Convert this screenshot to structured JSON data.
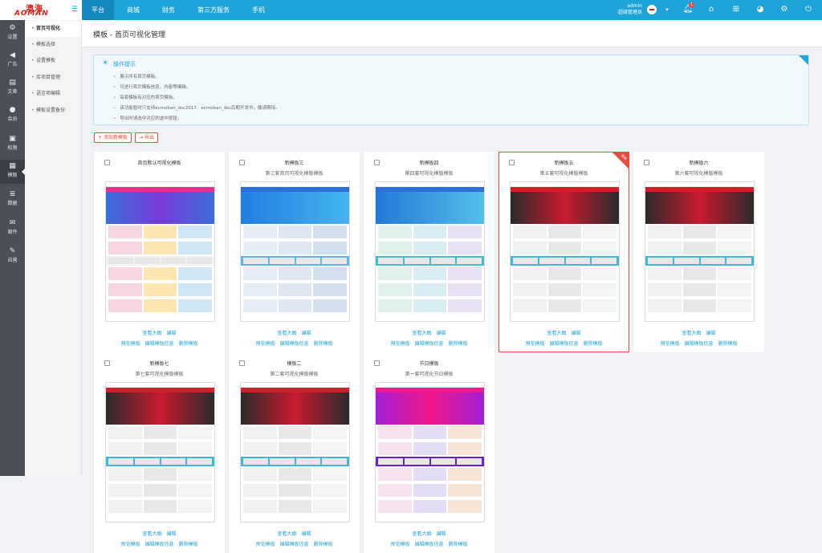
{
  "brand": {
    "line1": "澳海",
    "line2": "AOMAN"
  },
  "topnav": {
    "items": [
      "平台",
      "商城",
      "财务",
      "第三方服务",
      "手机"
    ],
    "active": 0
  },
  "user": {
    "name": "admin",
    "role": "超级管理员"
  },
  "notification_count": "1",
  "sidebar": {
    "items": [
      "设置",
      "广告",
      "文章",
      "会员",
      "权限",
      "模板",
      "数据",
      "邮件",
      "自营"
    ],
    "active": 5
  },
  "subnav": {
    "items": [
      "首页可视化",
      "模板选择",
      "设置模板",
      "库项目管理",
      "语言项编辑",
      "模板设置备份"
    ],
    "active": 0
  },
  "page_title": "模板 - 首页可视化管理",
  "tips": {
    "title": "操作提示",
    "lines": [
      "展示所有首页模板。",
      "可进行首页模板信息，内容等编辑。",
      "每套模板有对应的首页模板。",
      "该功能暂时只支持ecmoban_dsc2017、ecmoban_dsc后期开发中，敬请期待。",
      "导出时请选中对应的选中按钮。"
    ]
  },
  "buttons": {
    "add": "添加新模板",
    "export": "导出"
  },
  "card_links": {
    "view": "查看大图",
    "edit": "编辑",
    "preview": "预览模板",
    "edit_info": "编辑模板信息",
    "delete": "删除模板"
  },
  "badge_current": "使用",
  "templates": [
    {
      "name": "首页默认可视化模板",
      "desc": "",
      "selected": false,
      "theme": "pink"
    },
    {
      "name": "新模板三",
      "desc": "第三套首页可视化模版模板",
      "selected": false,
      "theme": "blue"
    },
    {
      "name": "新模板四",
      "desc": "第四套可视化模版模板",
      "selected": false,
      "theme": "blue2"
    },
    {
      "name": "新模板五",
      "desc": "第五套可视化模版模板",
      "selected": true,
      "theme": "red"
    },
    {
      "name": "新模板六",
      "desc": "第六套可视化模版模板",
      "selected": false,
      "theme": "red"
    },
    {
      "name": "新模板七",
      "desc": "第七套可视化模版模板",
      "selected": false,
      "theme": "red"
    },
    {
      "name": "模板二",
      "desc": "第二套可视化模版模板",
      "selected": false,
      "theme": "red"
    },
    {
      "name": "节日模板",
      "desc": "第一套可视化节日模板",
      "selected": false,
      "theme": "fest"
    }
  ],
  "colors": {
    "primary": "#1ea4d8",
    "accent": "#e84c3d",
    "sidebar": "#4b5058"
  }
}
